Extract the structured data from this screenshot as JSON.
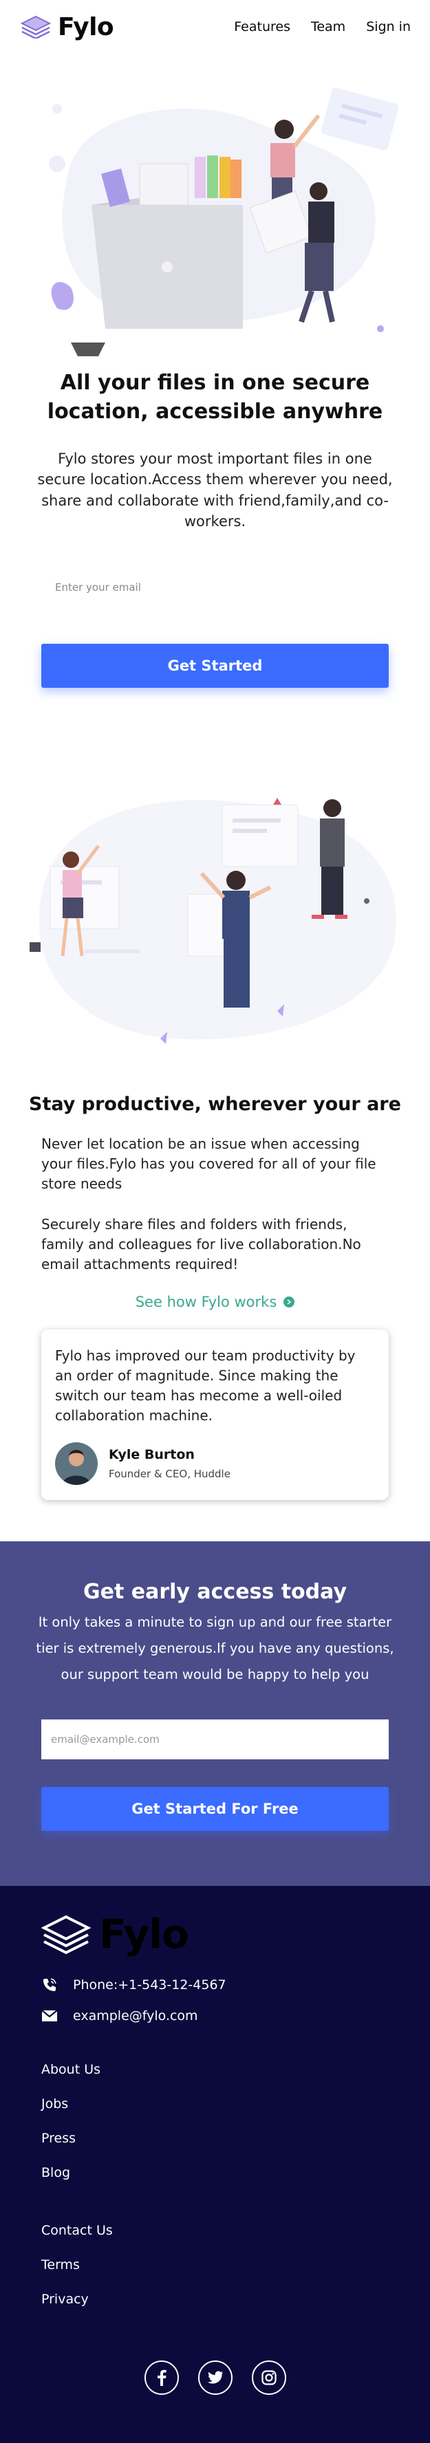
{
  "nav": {
    "brand": "Fylo",
    "links": [
      "Features",
      "Team",
      "Sign in"
    ]
  },
  "hero": {
    "title": "All your files in one secure location, accessible anywhre",
    "description": "Fylo stores your most important files in one secure location.Access them wherever you need, share and collaborate with friend,family,and co-workers.",
    "email_placeholder": "Enter your email",
    "cta_label": "Get Started"
  },
  "productive": {
    "title": "Stay productive, wherever your are",
    "p1": "Never let location be an issue when accessing your files.Fylo has you covered for all of your file store needs",
    "p2": "Securely share files and folders with friends, family and colleagues for live collaboration.No email attachments required!",
    "link_label": "See how Fylo works"
  },
  "testimonial": {
    "quote": "Fylo has improved our team productivity by an order of magnitude. Since making the switch our team has mecome a well-oiled collaboration machine.",
    "name": "Kyle Burton",
    "role": "Founder & CEO, Huddle"
  },
  "early_access": {
    "title": "Get early access today",
    "description": "It only takes a minute to sign up and our free starter tier is extremely generous.If you have any questions, our support team would be happy to help you",
    "email_placeholder": "email@example.com",
    "cta_label": "Get Started For Free"
  },
  "footer": {
    "brand": "Fylo",
    "phone": "Phone:+1-543-12-4567",
    "email": "example@fylo.com",
    "links_group1": [
      "About Us",
      "Jobs",
      "Press",
      "Blog"
    ],
    "links_group2": [
      "Contact Us",
      "Terms",
      "Privacy"
    ],
    "socials": [
      "facebook-icon",
      "twitter-icon",
      "instagram-icon"
    ]
  },
  "colors": {
    "primary": "#3b6bff",
    "accent_green": "#3aa88e",
    "early_bg": "#4a4d8a",
    "footer_bg": "#0c0a3c"
  }
}
